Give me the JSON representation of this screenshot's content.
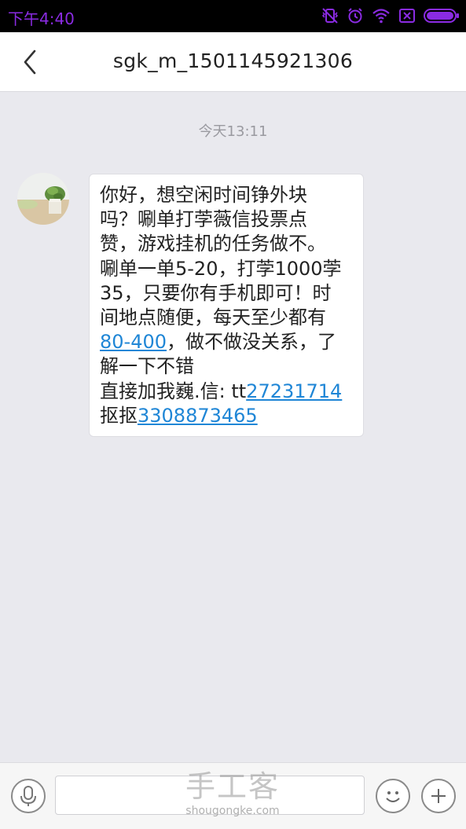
{
  "status_bar": {
    "time": "下午4:40",
    "icons": [
      "vibrate-icon",
      "alarm-icon",
      "wifi-icon",
      "no-sim-icon",
      "battery-icon"
    ],
    "accent_color": "#8a2be2"
  },
  "header": {
    "back_icon": "chevron-left-icon",
    "title": "sgk_m_1501145921306"
  },
  "thread": {
    "timestamp": "今天13:11",
    "message": {
      "lines": [
        [
          {
            "text": "你好，想空闲时间铮外块"
          }
        ],
        [
          {
            "text": "吗？唰单打茡薇信投票点"
          }
        ],
        [
          {
            "text": "赞，游戏挂机的任务做不。"
          }
        ],
        [
          {
            "text": "唰单一单5-20，打茡1000茡"
          }
        ],
        [
          {
            "text": "35，只要你有手机即可！时"
          }
        ],
        [
          {
            "text": "间地点随便，每天至少都有"
          }
        ],
        [
          {
            "text": "80-400",
            "link": true
          },
          {
            "text": "，做不做没关系，了"
          }
        ],
        [
          {
            "text": "解一下不错"
          }
        ],
        [
          {
            "text": "直接加我巍.信: tt"
          },
          {
            "text": "27231714",
            "link": true
          }
        ],
        [
          {
            "text": "抠抠"
          },
          {
            "text": "3308873465",
            "link": true
          }
        ]
      ]
    }
  },
  "input_bar": {
    "mic_icon": "microphone-icon",
    "emoji_icon": "emoji-icon",
    "plus_icon": "plus-icon",
    "input_value": "",
    "watermark_cn": "手工客",
    "watermark_en": "shougongke.com"
  },
  "colors": {
    "background": "#e9e9ee",
    "link": "#1f86d6",
    "header_bg": "#ffffff"
  }
}
